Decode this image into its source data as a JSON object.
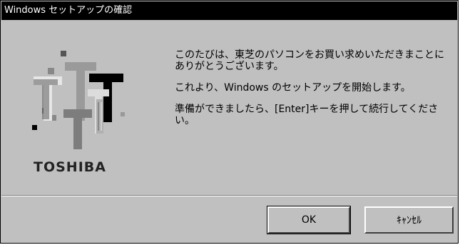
{
  "window": {
    "title": "Windows セットアップの確認"
  },
  "logo": {
    "brand": "TOSHIBA",
    "icon": "toshiba-logo-icon"
  },
  "messages": [
    "このたびは、東芝のパソコンをお買い求めいただきまことにありがとうございます。",
    "これより、Windows のセットアップを開始します。",
    "準備ができましたら、[Enter]キーを押して続行してください。"
  ],
  "buttons": {
    "ok": "OK",
    "cancel": "ｷｬﾝｾﾙ"
  },
  "colors": {
    "titlebar": "#000000",
    "dialog": "#c0c0c0"
  }
}
